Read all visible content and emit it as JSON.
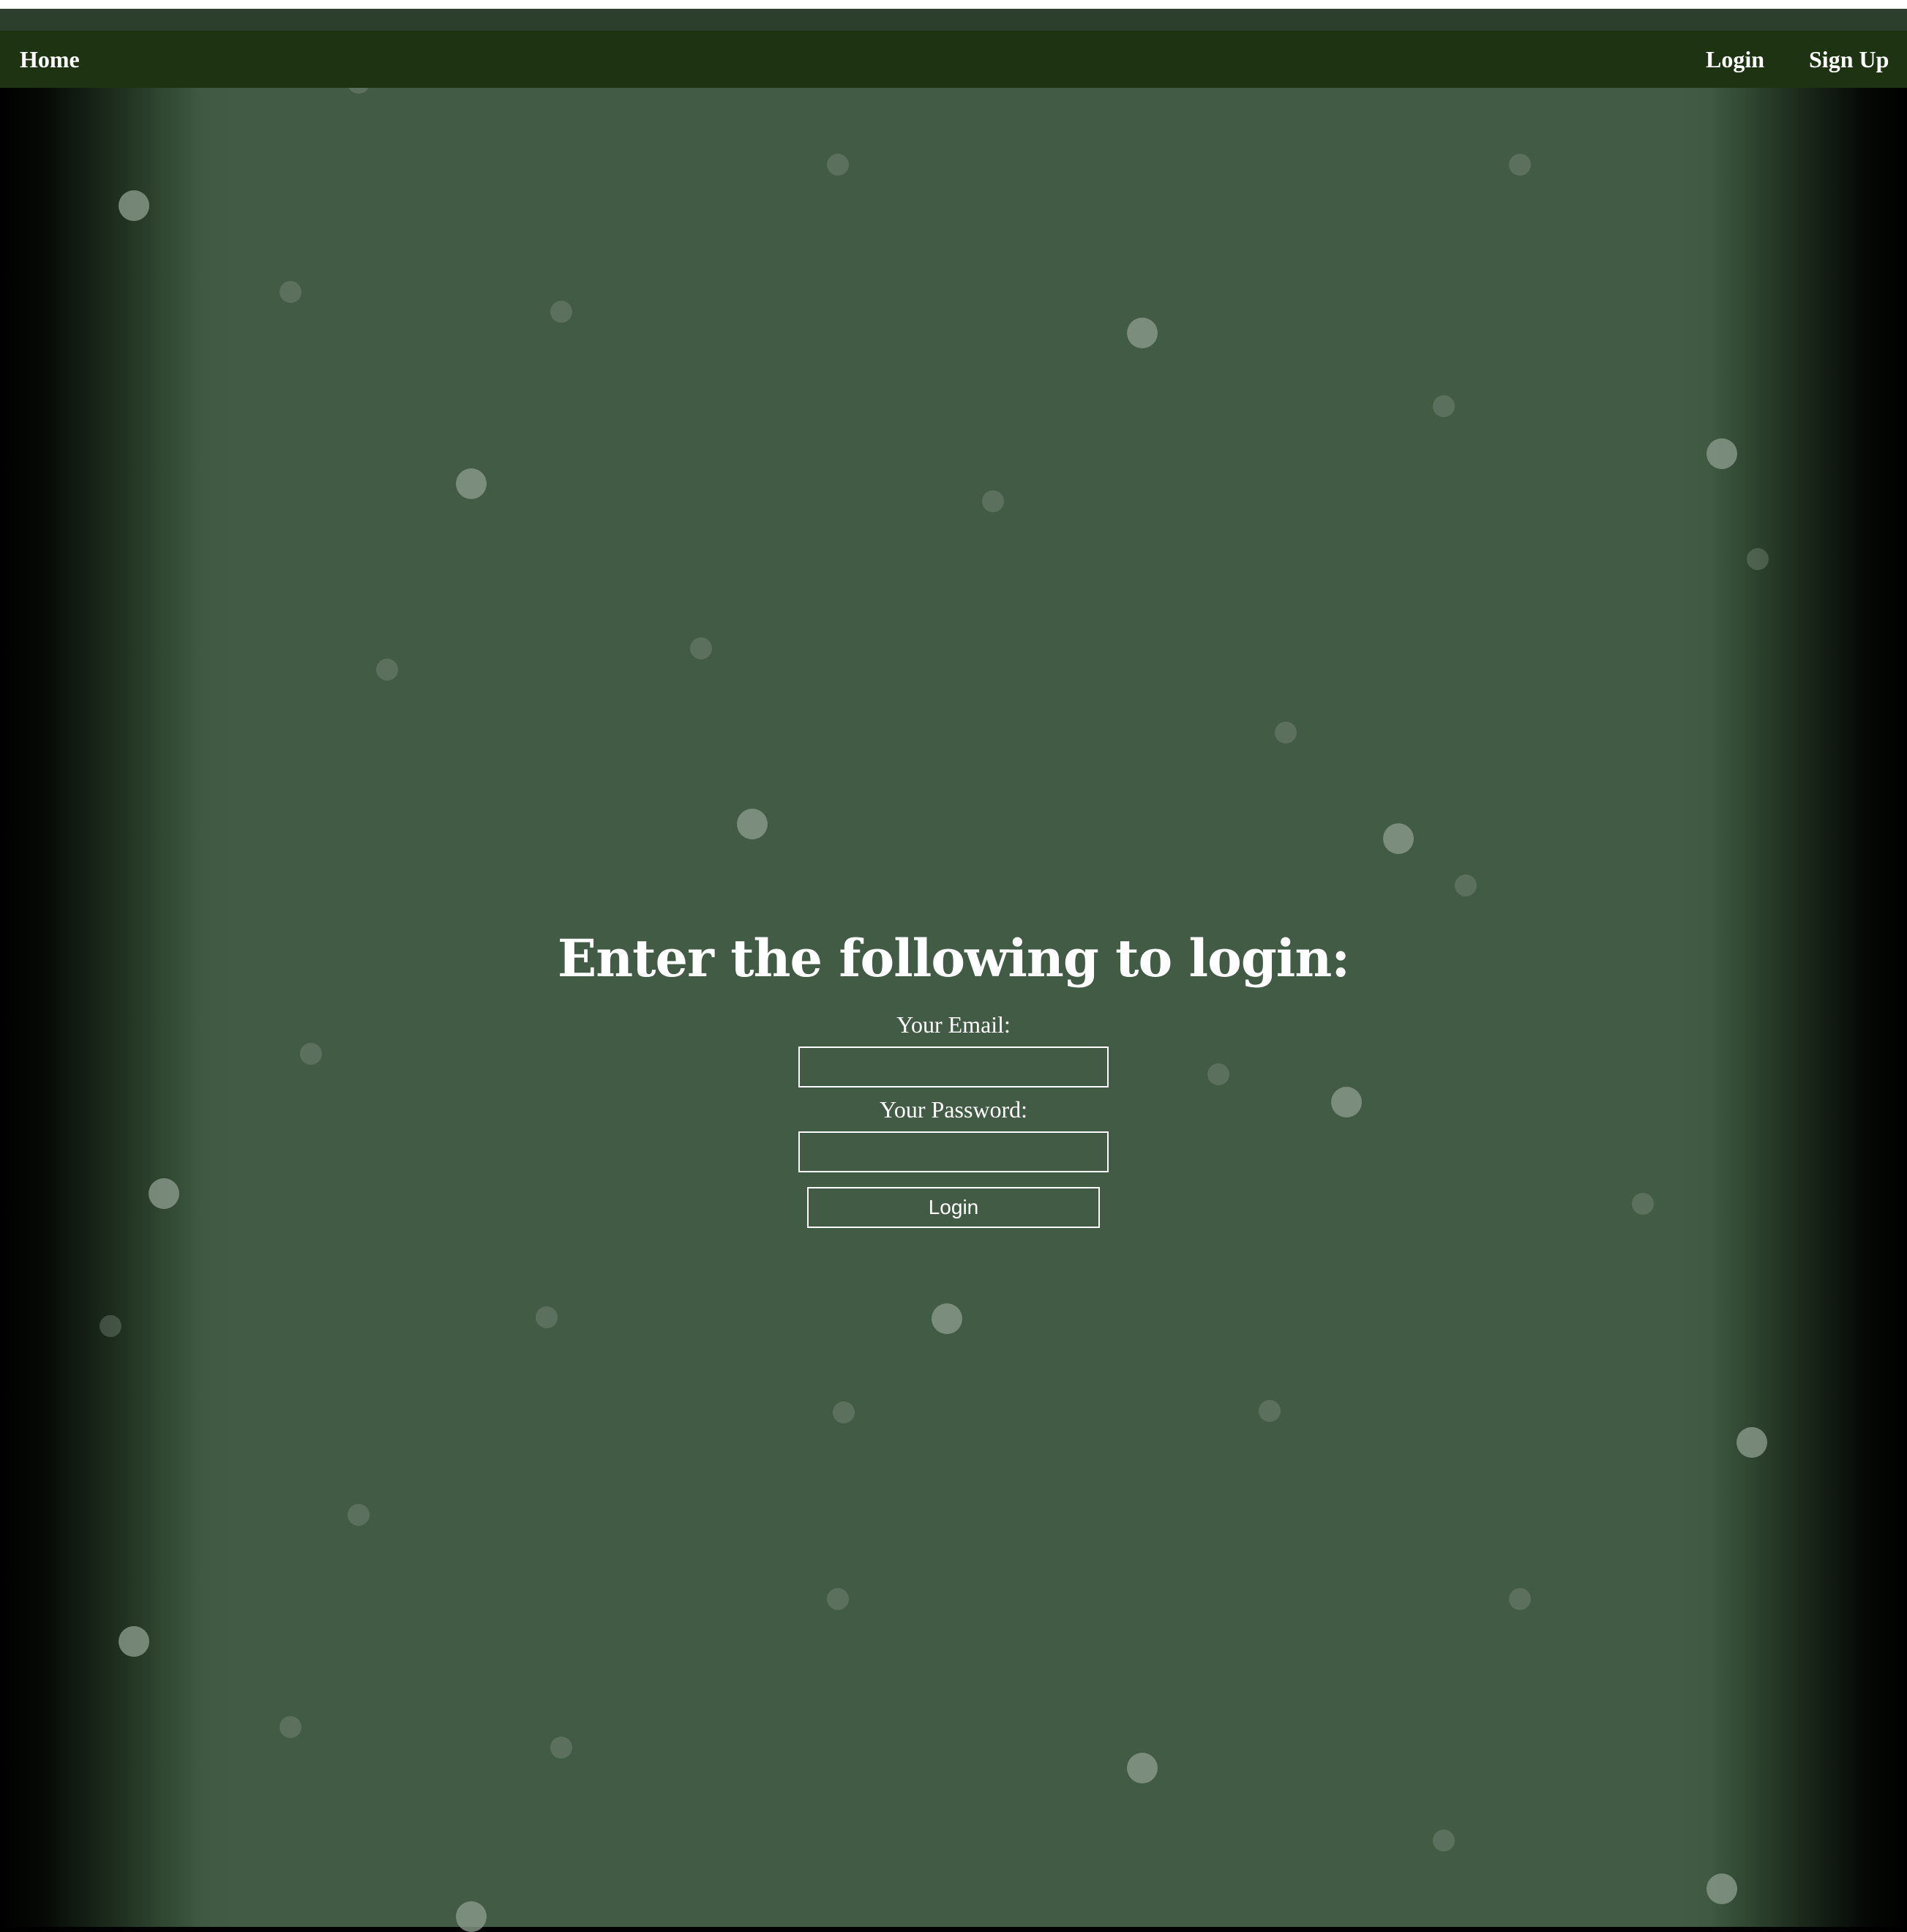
{
  "navbar": {
    "home_label": "Home",
    "login_label": "Login",
    "signup_label": "Sign Up"
  },
  "form": {
    "heading": "Enter the following to login:",
    "email_label": "Your Email:",
    "email_value": "",
    "password_label": "Your Password:",
    "password_value": "",
    "submit_label": "Login"
  },
  "colors": {
    "navbar_bg": "#1d3311",
    "page_bg": "#425b44",
    "text": "#ffffff"
  }
}
